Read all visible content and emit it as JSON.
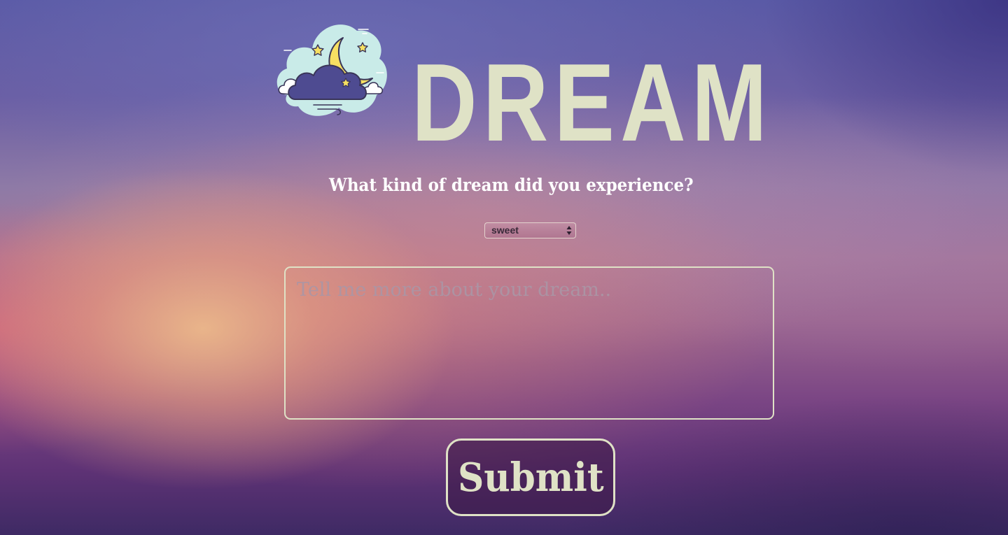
{
  "header": {
    "title": "DREAM",
    "logo_icon": "moon-cloud-icon"
  },
  "form": {
    "question": "What kind of dream did you experience?",
    "dream_type": {
      "selected": "sweet"
    },
    "details": {
      "value": "",
      "placeholder": "Tell me more about your dream.."
    },
    "submit_label": "Submit"
  },
  "colors": {
    "accent": "#dfe2c6",
    "moon": "#f7e062",
    "cloud_back": "#c9ebe8",
    "cloud_front": "#4e4b91"
  }
}
